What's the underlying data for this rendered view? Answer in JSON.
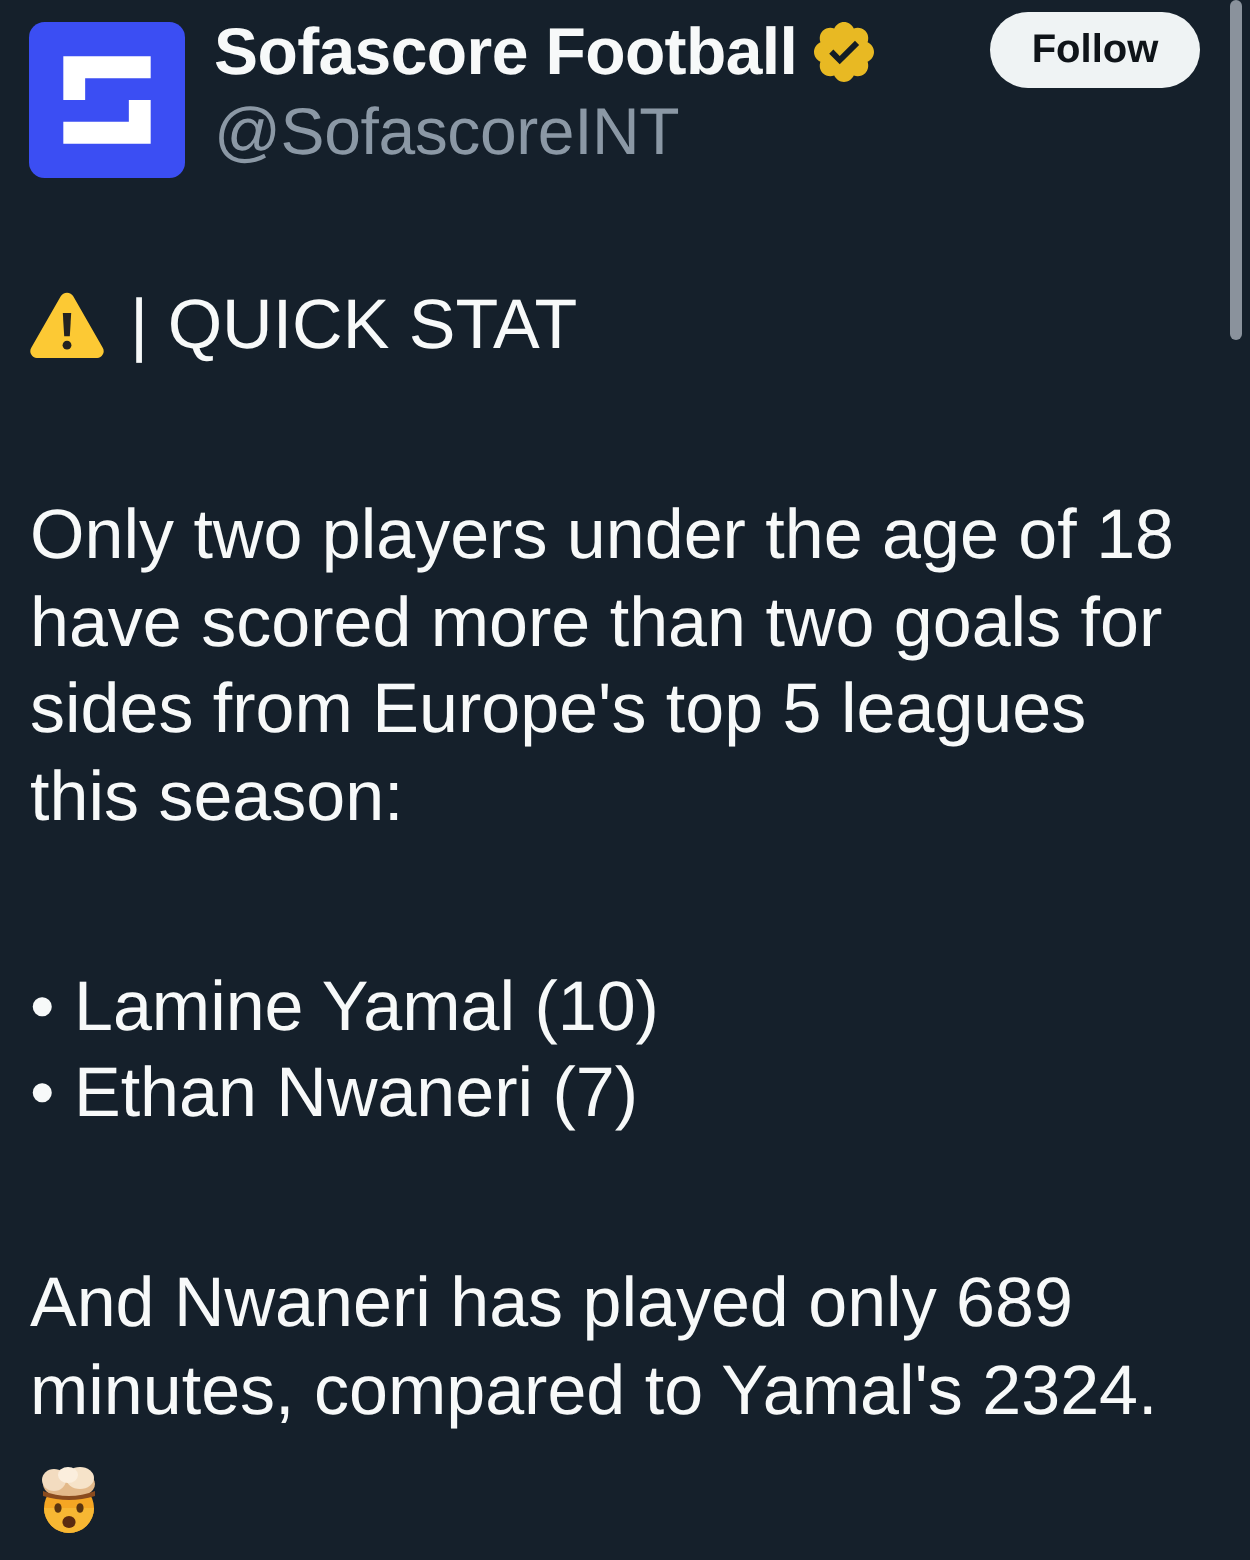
{
  "author": {
    "name": "Sofascore Football",
    "handle": "@SofascoreINT",
    "verified": true
  },
  "follow_button": {
    "label": "Follow"
  },
  "paragraphs": [
    {
      "kind": "alert",
      "text": "| QUICK STAT"
    },
    {
      "kind": "text",
      "text": "Only two players under the age of 18 have scored more than two goals for sides from Europe's top 5 leagues this season:"
    },
    {
      "kind": "list",
      "items": [
        "• Lamine Yamal (10)",
        "• Ethan Nwaneri (7)"
      ]
    },
    {
      "kind": "text",
      "text": "And Nwaneri has played only 689 minutes, compared to Yamal's 2324."
    },
    {
      "kind": "emoji"
    }
  ]
}
